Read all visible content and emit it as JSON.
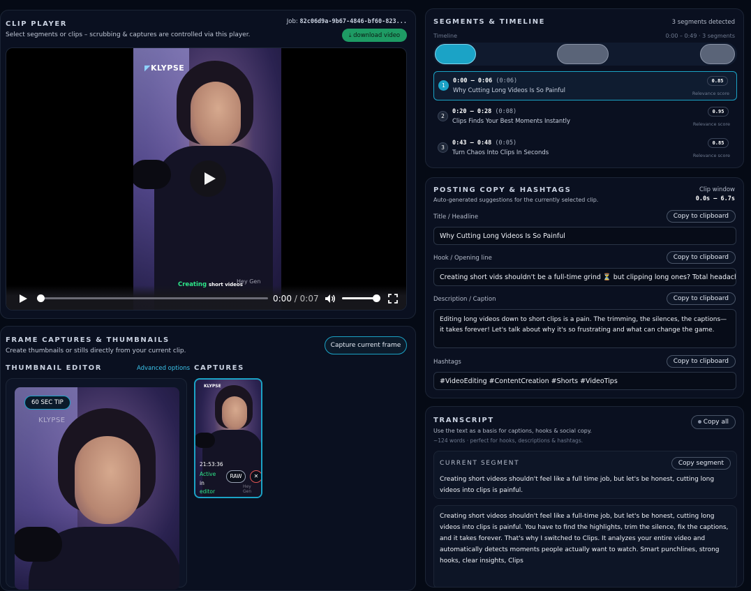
{
  "player": {
    "title": "CLIP PLAYER",
    "subtitle": "Select segments or clips – scrubbing & captures are controlled via this player.",
    "job_label": "Job:",
    "job_id": "82c06d9a-9b67-4846-bf60-823...",
    "download_label": "download video",
    "brand": "KLYPSE",
    "caption_green": "Creating",
    "caption_white": "short videos",
    "watermark": "Hey Gen",
    "time_current": "0:00",
    "time_sep": "/",
    "time_total": "0:07",
    "progress": 0.0,
    "volume": 1.0
  },
  "captures_panel": {
    "title": "FRAME CAPTURES & THUMBNAILS",
    "subtitle": "Create thumbnails or stills directly from your current clip.",
    "capture_button": "Capture current frame",
    "editor_title": "THUMBNAIL EDITOR",
    "advanced_link": "Advanced options",
    "captures_title": "CAPTURES",
    "editor_tag": "60 SEC TIP",
    "editor_brand": "KLYPSE",
    "capture_card": {
      "brand": "KLYPSE",
      "time": "21:53:36",
      "status": [
        "Active",
        "in",
        "editor"
      ],
      "raw_label": "RAW",
      "close_label": "✕",
      "watermark": "Hey Gen"
    }
  },
  "segments": {
    "title": "SEGMENTS & TIMELINE",
    "count_text": "3 segments detected",
    "timeline_label": "Timeline",
    "timeline_range": "0:00 – 0:49 · 3 segments",
    "score_label": "Relevance score",
    "items": [
      {
        "num": "1",
        "range": "0:00 – 0:06",
        "dur": "(0:06)",
        "title": "Why Cutting Long Videos Is So Painful",
        "score": "0.85"
      },
      {
        "num": "2",
        "range": "0:20 – 0:28",
        "dur": "(0:08)",
        "title": "Clips Finds Your Best Moments Instantly",
        "score": "0.95"
      },
      {
        "num": "3",
        "range": "0:43 – 0:48",
        "dur": "(0:05)",
        "title": "Turn Chaos Into Clips In Seconds",
        "score": "0.85"
      }
    ]
  },
  "posting": {
    "title": "POSTING COPY & HASHTAGS",
    "subtitle": "Auto-generated suggestions for the currently selected clip.",
    "window_label": "Clip window",
    "window_value": "0.0s – 6.7s",
    "copy_label": "Copy to clipboard",
    "title_label": "Title / Headline",
    "title_value": "Why Cutting Long Videos Is So Painful",
    "hook_label": "Hook / Opening line",
    "hook_value": "Creating short vids shouldn't be a full-time grind ⏳ but clipping long ones? Total headache!",
    "desc_label": "Description / Caption",
    "desc_value": "Editing long videos down to short clips is a pain. The trimming, the silences, the captions—it takes forever! Let's talk about why it's so frustrating and what can change the game.",
    "hashtags_label": "Hashtags",
    "hashtags_value": "#VideoEditing #ContentCreation #Shorts #VideoTips"
  },
  "transcript": {
    "title": "TRANSCRIPT",
    "subtitle": "Use the text as a basis for captions, hooks & social copy.",
    "meta": "~124 words · perfect for hooks, descriptions & hashtags.",
    "copy_all": "Copy all",
    "current_title": "CURRENT SEGMENT",
    "copy_segment": "Copy segment",
    "current_text": "Creating short videos shouldn't feel like a full time job, but let's be honest, cutting long videos into clips is painful.",
    "full_text": "Creating short videos shouldn't feel like a full-time job, but let's be honest, cutting long videos into clips is painful. You have to find the highlights, trim the silence, fix the captions, and it takes forever. That's why I switched to Clips. It analyzes your entire video and automatically detects moments people actually want to watch. Smart punchlines, strong hooks, clear insights, Clips"
  },
  "colors": {
    "accent_cyan": "#1ba3c6",
    "accent_green": "#1e9b64",
    "panel_bg": "#0a1020",
    "page_bg": "#050a15"
  }
}
